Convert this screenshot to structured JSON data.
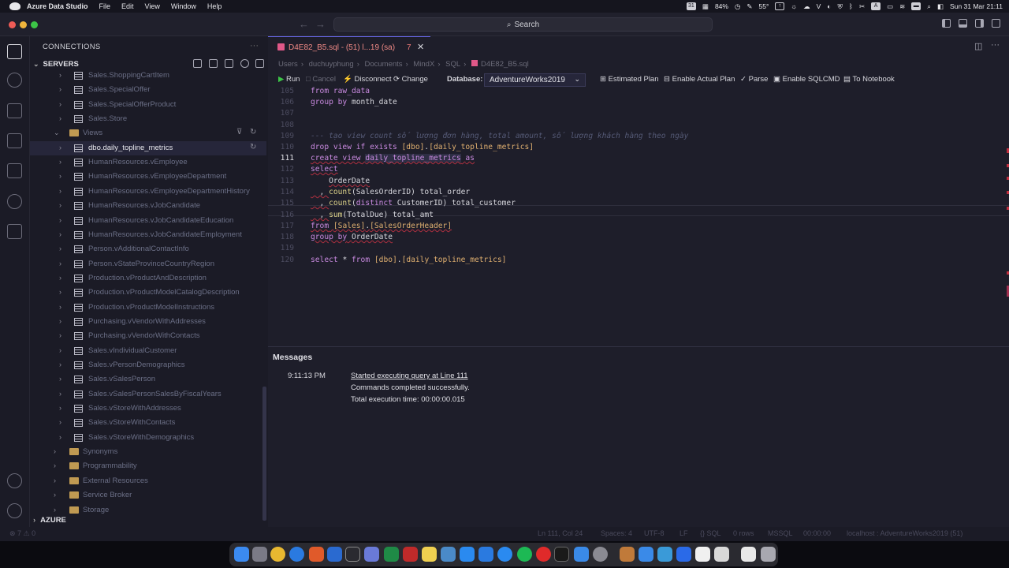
{
  "menubar": {
    "app": "Azure Data Studio",
    "items": [
      "File",
      "Edit",
      "View",
      "Window",
      "Help"
    ],
    "calendar": "31",
    "battery": "84%",
    "temperature": "55°",
    "datetime": "Sun 31 Mar  21:11"
  },
  "titlebar": {
    "search": "Search"
  },
  "sidebar": {
    "header": "CONNECTIONS",
    "servers_label": "SERVERS",
    "azure_label": "AZURE",
    "tables": [
      "Sales.ShoppingCartItem",
      "Sales.SpecialOffer",
      "Sales.SpecialOfferProduct",
      "Sales.Store"
    ],
    "views_label": "Views",
    "views": [
      "dbo.daily_topline_metrics",
      "HumanResources.vEmployee",
      "HumanResources.vEmployeeDepartment",
      "HumanResources.vEmployeeDepartmentHistory",
      "HumanResources.vJobCandidate",
      "HumanResources.vJobCandidateEducation",
      "HumanResources.vJobCandidateEmployment",
      "Person.vAdditionalContactInfo",
      "Person.vStateProvinceCountryRegion",
      "Production.vProductAndDescription",
      "Production.vProductModelCatalogDescription",
      "Production.vProductModelInstructions",
      "Purchasing.vVendorWithAddresses",
      "Purchasing.vVendorWithContacts",
      "Sales.vIndividualCustomer",
      "Sales.vPersonDemographics",
      "Sales.vSalesPerson",
      "Sales.vSalesPersonSalesByFiscalYears",
      "Sales.vStoreWithAddresses",
      "Sales.vStoreWithContacts",
      "Sales.vStoreWithDemographics"
    ],
    "folders": [
      "Synonyms",
      "Programmability",
      "External Resources",
      "Service Broker",
      "Storage"
    ]
  },
  "editor": {
    "tab_title": "D4E82_B5.sql - (51) l...19 (sa)",
    "tab_modified": "7",
    "breadcrumb": [
      "Users",
      "duchuyphung",
      "Documents",
      "MindX",
      "SQL",
      "D4E82_B5.sql"
    ],
    "toolbar": {
      "run": "Run",
      "cancel": "Cancel",
      "disconnect": "Disconnect",
      "change": "Change",
      "database_label": "Database:",
      "database_value": "AdventureWorks2019",
      "estimated_plan": "Estimated Plan",
      "enable_actual_plan": "Enable Actual Plan",
      "parse": "Parse",
      "enable_sqlcmd": "Enable SQLCMD",
      "to_notebook": "To Notebook"
    },
    "line_numbers": [
      "105",
      "106",
      "107",
      "108",
      "109",
      "110",
      "111",
      "112",
      "113",
      "114",
      "115",
      "116",
      "117",
      "118",
      "119",
      "120"
    ],
    "code": {
      "l105": "from raw_data",
      "l106_kw": "group by",
      "l106_id": "month_date",
      "l109": "--- tạo view count số lượng đơn hàng, total amount, số lượng khách hàng theo ngày",
      "l110_kw": "drop view if exists",
      "l110_b1": "[dbo]",
      "l110_b2": "[daily_topline_metrics]",
      "l111_kw1": "create view",
      "l111_name": "daily_topline_metrics",
      "l111_kw2": "as",
      "l112": "select",
      "l113": "OrderDate",
      "l114_fn": "count",
      "l114_arg": "SalesOrderID",
      "l114_alias": "total_order",
      "l115_fn": "count",
      "l115_kw": "distinct",
      "l115_arg": "CustomerID",
      "l115_alias": "total_customer",
      "l116_fn": "sum",
      "l116_arg": "TotalDue",
      "l116_alias": "total_amt",
      "l117_kw": "from",
      "l117_b1": "[Sales]",
      "l117_b2": "[SalesOrderHeader]",
      "l118_kw": "group by",
      "l118_id": "OrderDate",
      "l120_kw1": "select",
      "l120_star": "*",
      "l120_kw2": "from",
      "l120_b1": "[dbo]",
      "l120_b2": "[daily_topline_metrics]"
    }
  },
  "messages": {
    "title": "Messages",
    "time": "9:11:13 PM",
    "lines": [
      "Started executing query at Line 111",
      "Commands completed successfully.",
      "Total execution time: 00:00:00.015"
    ]
  },
  "statusbar": {
    "problems": "⊗ 7 ⚠ 0",
    "position": "Ln 111, Col 24",
    "spaces": "Spaces: 4",
    "encoding": "UTF-8",
    "eol": "LF",
    "language": "SQL",
    "rows": "0 rows",
    "provider": "MSSQL",
    "elapsed": "00:00:00",
    "connection": "localhost : AdventureWorks2019 (51)"
  },
  "colors": {
    "accent": "#6a6af0",
    "folder": "#c09a52",
    "error": "#c03040",
    "sql_icon": "#e05888"
  }
}
